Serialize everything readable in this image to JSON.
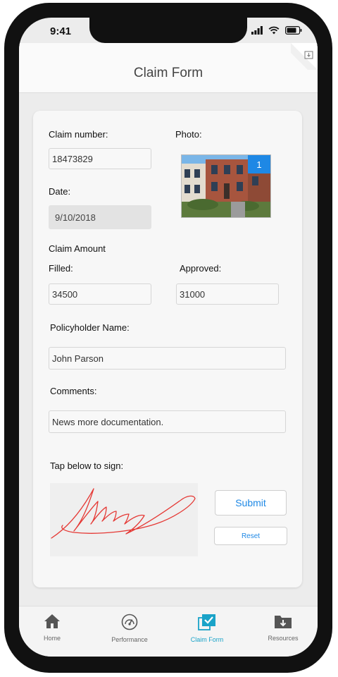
{
  "status": {
    "time": "9:41"
  },
  "header": {
    "title": "Claim Form"
  },
  "form": {
    "claim_number_label": "Claim number:",
    "claim_number_value": "18473829",
    "photo_label": "Photo:",
    "photo_count": "1",
    "date_label": "Date:",
    "date_value": "9/10/2018",
    "claim_amount_label": "Claim Amount",
    "filled_label": "Filled:",
    "filled_value": "34500",
    "approved_label": "Approved:",
    "approved_value": "31000",
    "policyholder_label": "Policyholder Name:",
    "policyholder_value": "John Parson",
    "comments_label": "Comments:",
    "comments_value": "News more documentation.",
    "sign_label": "Tap below to sign:",
    "submit_label": "Submit",
    "reset_label": "Reset"
  },
  "tabs": [
    {
      "label": "Home",
      "icon": "home-icon"
    },
    {
      "label": "Performance",
      "icon": "gauge-icon"
    },
    {
      "label": "Claim Form",
      "icon": "checklist-icon"
    },
    {
      "label": "Resources",
      "icon": "folder-download-icon"
    }
  ],
  "colors": {
    "accent": "#1e88e5",
    "tab_active": "#1aa3c8",
    "signature": "#e53935"
  }
}
